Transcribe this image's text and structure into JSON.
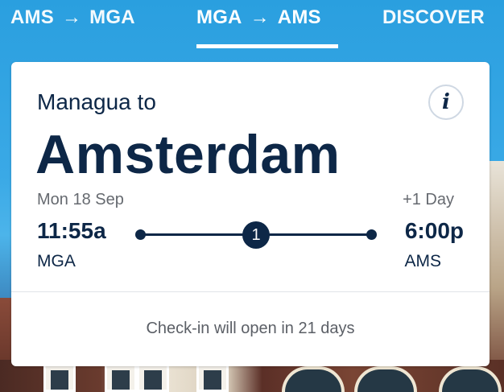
{
  "tabs": [
    {
      "from": "AMS",
      "arrow": "→",
      "to": "MGA",
      "active": false
    },
    {
      "from": "MGA",
      "arrow": "→",
      "to": "AMS",
      "active": true
    },
    {
      "label": "DISCOVER",
      "active": false
    }
  ],
  "card": {
    "origin_line": "Managua to",
    "destination": "Amsterdam",
    "info_icon_glyph": "i",
    "departure": {
      "date": "Mon 18 Sep",
      "time": "11:55a",
      "airport": "MGA"
    },
    "arrival": {
      "day_offset": "+1 Day",
      "time": "6:00p",
      "airport": "AMS"
    },
    "stops": "1",
    "checkin_message": "Check-in will open in 21 days"
  },
  "colors": {
    "brand_navy": "#0d2747",
    "tab_text": "#ffffff",
    "card_bg": "#ffffff"
  },
  "icons": [
    "info-icon",
    "arrow-right-icon",
    "stop-count-badge"
  ]
}
